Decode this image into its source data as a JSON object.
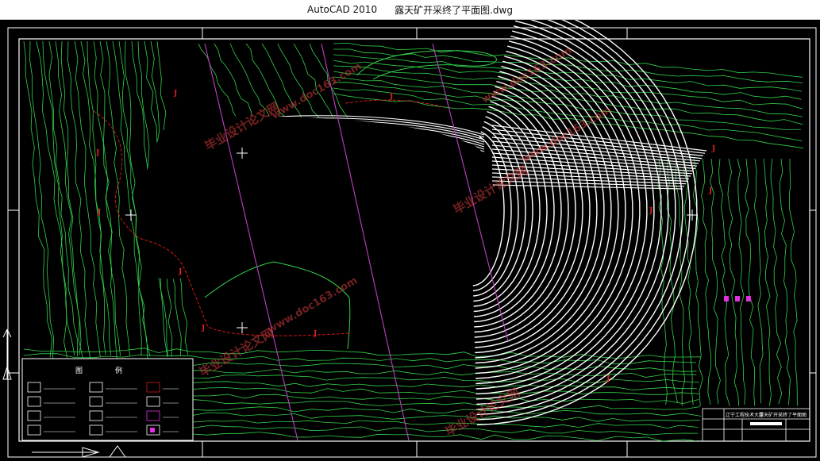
{
  "window": {
    "app_name": "AutoCAD 2010",
    "document": "露天矿开采终了平面图.dwg"
  },
  "drawing": {
    "colors": {
      "background": "#000000",
      "contour": "#33d24a",
      "bench": "#ffffff",
      "grid_line": "#c040c0",
      "boundary": "#d01818",
      "watermark": "#d23c3c",
      "title_block": "#ffffff"
    },
    "watermarks": [
      "毕业设计论文网",
      "www.doc163.com"
    ],
    "legend": {
      "title": "图",
      "title2": "例"
    },
    "title_block": {
      "org": "辽宁工程技术大学",
      "drawing_name": "露天矿开采终了平面图"
    }
  }
}
